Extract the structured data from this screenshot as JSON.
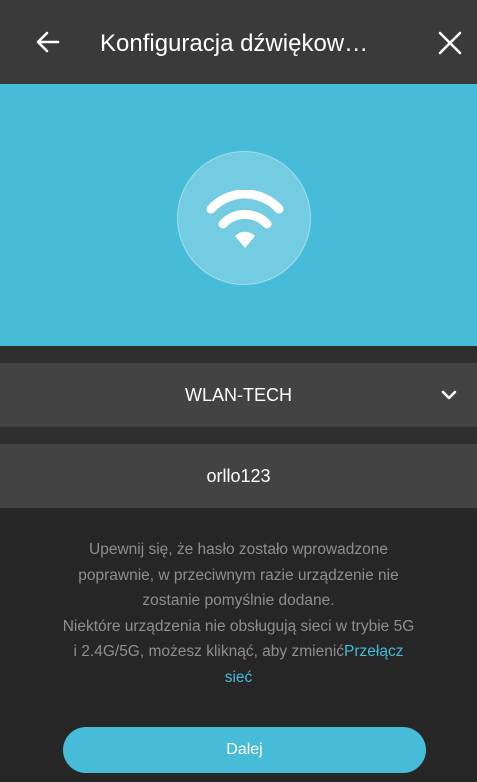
{
  "header": {
    "title": "Konfiguracja dźwiękow…",
    "back_icon": "arrow-left-icon",
    "close_icon": "close-icon"
  },
  "hero": {
    "icon": "wifi-icon"
  },
  "network": {
    "ssid": "WLAN-TECH",
    "dropdown_icon": "chevron-down-icon"
  },
  "password": {
    "value": "orllo123"
  },
  "info": {
    "line1": "Upewnij się, że hasło zostało wprowadzone",
    "line2": "poprawnie, w przeciwnym razie urządzenie nie",
    "line3": "zostanie pomyślnie dodane.",
    "line4": "Niektóre urządzenia nie obsługują sieci w trybie 5G",
    "line5": "i 2.4G/5G, możesz kliknąć, aby zmienić",
    "link_part1": "Przełącz",
    "link_part2": "sieć"
  },
  "actions": {
    "next_label": "Dalej"
  },
  "colors": {
    "accent": "#46bcd9",
    "background": "#262626",
    "header": "#3a3a3a",
    "row": "#434343",
    "muted_text": "#8f8f8f"
  }
}
